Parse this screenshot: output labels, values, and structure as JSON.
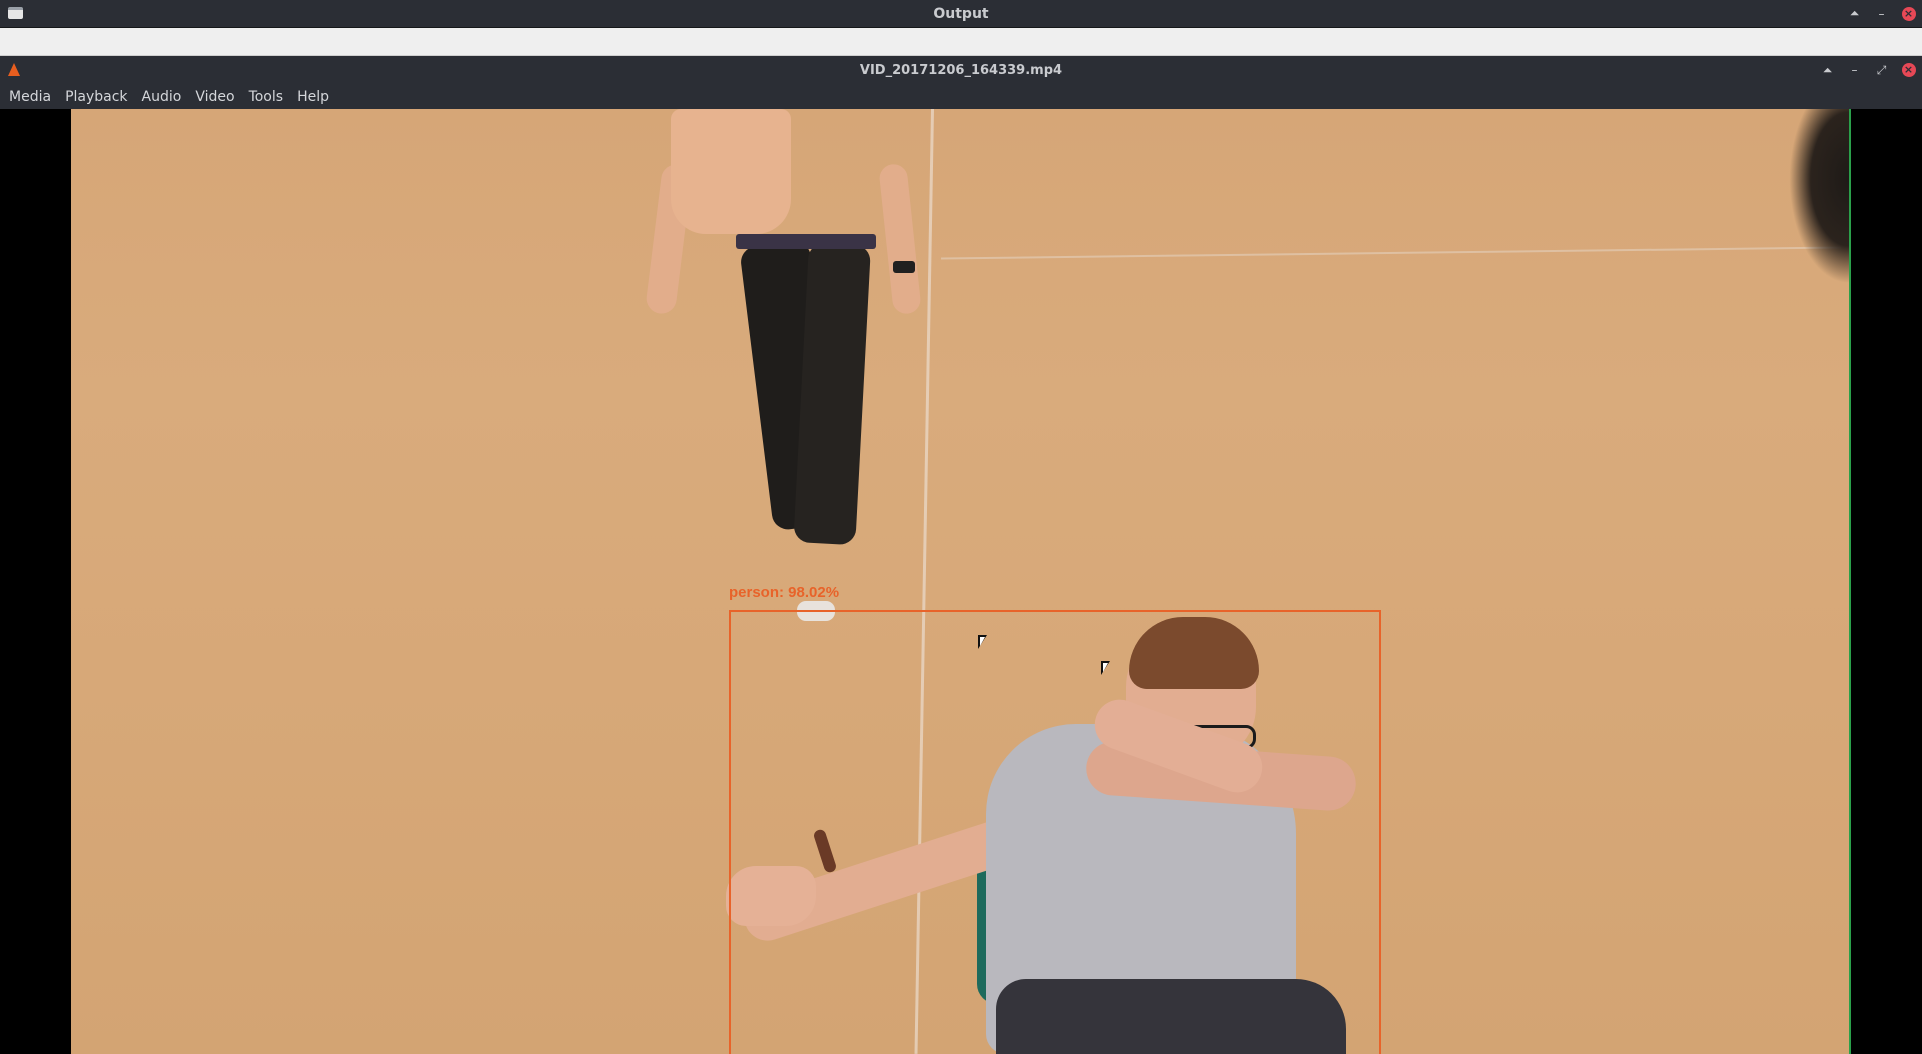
{
  "outer_window": {
    "title": "Output",
    "controls": {
      "up": "⏶",
      "minimize": "–",
      "close": "×"
    }
  },
  "player_window": {
    "title": "VID_20171206_164339.mp4",
    "controls": {
      "up": "⏶",
      "minimize": "–",
      "maximize": "⤢",
      "close": "×"
    }
  },
  "menu": {
    "items": [
      "Media",
      "Playback",
      "Audio",
      "Video",
      "Tools",
      "Help"
    ]
  },
  "video": {
    "detection": {
      "label": "person: 98.02%"
    },
    "colors": {
      "box": "#e8632a",
      "floor": "#d7a878"
    }
  }
}
